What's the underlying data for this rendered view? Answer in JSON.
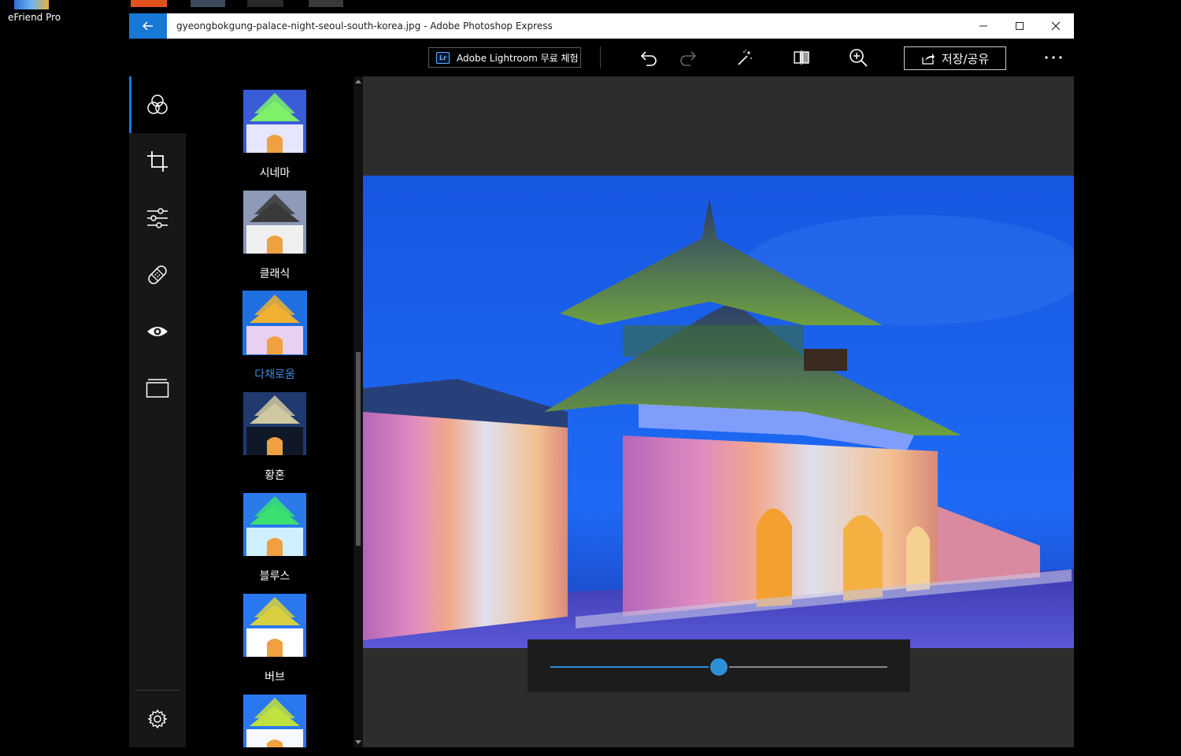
{
  "desktop": {
    "icon_label": "eFriend Pro"
  },
  "window": {
    "title": "gyeongbokgung-palace-night-seoul-south-korea.jpg - Adobe Photoshop Express"
  },
  "toolbar": {
    "lightroom_badge": "Lr",
    "lightroom_label": "Adobe Lightroom 무료 체험",
    "save_share_label": "저장/공유"
  },
  "looks": [
    {
      "label": "시네마",
      "selected": false
    },
    {
      "label": "클래식",
      "selected": false
    },
    {
      "label": "다채로움",
      "selected": true
    },
    {
      "label": "황혼",
      "selected": false
    },
    {
      "label": "블루스",
      "selected": false
    },
    {
      "label": "버브",
      "selected": false
    }
  ],
  "intensity": {
    "value": 0.5
  },
  "colors": {
    "accent": "#1c7ad6",
    "back_button": "#1778d6",
    "selected_label": "#3d8fe0"
  }
}
